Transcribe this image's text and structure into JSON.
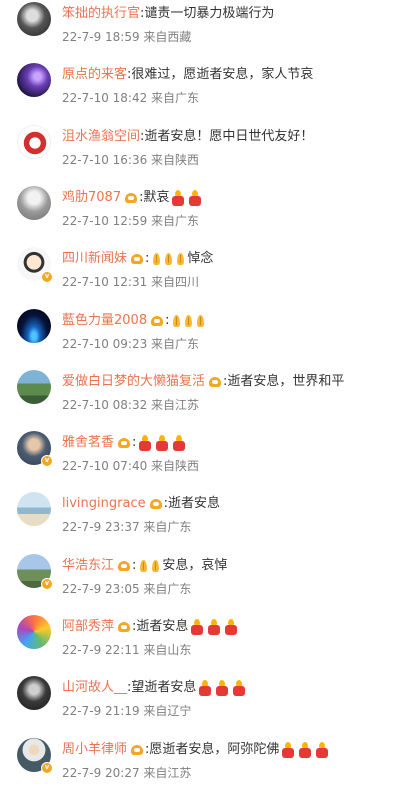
{
  "comments": [
    {
      "user": "笨拙的执行官",
      "text": ":谴责一切暴力极端行为",
      "badge": false,
      "fan": false,
      "emojis": [],
      "meta": "22-7-9 18:59 来自西藏",
      "avatar": "bw-portrait"
    },
    {
      "user": "原点的来客",
      "text": ":很难过，愿逝者安息，家人节哀",
      "badge": false,
      "fan": false,
      "emojis": [],
      "meta": "22-7-10 18:42 来自广东",
      "avatar": "galaxy"
    },
    {
      "user": "沮水渔翁空间",
      "text": ":逝者安息！愿中日世代友好！",
      "badge": false,
      "fan": false,
      "emojis": [],
      "meta": "22-7-10 16:36 来自陕西",
      "avatar": "red-seal"
    },
    {
      "user": "鸡肋7087",
      "text": ":默哀",
      "badge": false,
      "fan": true,
      "emojis": [
        "candle",
        "candle"
      ],
      "meta": "22-7-10 12:59 来自广东",
      "avatar": "gray-portrait"
    },
    {
      "user": "四川新闻妹",
      "text": "悼念",
      "badge": true,
      "fan": true,
      "emojis": [
        "colon",
        "pray",
        "pray",
        "pray"
      ],
      "meta": "22-7-10 12:31 来自四川",
      "avatar": "cartoon"
    },
    {
      "user": "藍色力量2008",
      "text": "",
      "badge": false,
      "fan": true,
      "emojis": [
        "colon",
        "pray",
        "pray",
        "pray"
      ],
      "meta": "22-7-10 09:23 来自广东",
      "avatar": "blue-planet"
    },
    {
      "user": "爱做白日梦的大懒猫复活",
      "text": ":逝者安息，世界和平",
      "badge": false,
      "fan": true,
      "emojis": [],
      "meta": "22-7-10 08:32 来自江苏",
      "avatar": "landscape"
    },
    {
      "user": "雅舍茗香",
      "text": "",
      "badge": true,
      "fan": true,
      "emojis": [
        "colon",
        "candle",
        "candle",
        "candle"
      ],
      "meta": "22-7-10 07:40 来自陕西",
      "avatar": "man-portrait"
    },
    {
      "user": "livingingrace",
      "text": ":逝者安息",
      "badge": false,
      "fan": true,
      "emojis": [],
      "meta": "22-7-9 23:37 来自广东",
      "avatar": "seaside"
    },
    {
      "user": "华浩东江",
      "text": "安息，哀悼",
      "badge": true,
      "fan": true,
      "emojis": [
        "colon",
        "pray",
        "pray"
      ],
      "meta": "22-7-9 23:05 来自广东",
      "avatar": "mountain"
    },
    {
      "user": "阿部秀萍",
      "text": ":逝者安息",
      "badge": false,
      "fan": true,
      "emojis": [
        "candle",
        "candle",
        "candle"
      ],
      "meta": "22-7-9 22:11 来自山东",
      "avatar": "colorful-bird"
    },
    {
      "user": "山河故人__",
      "text": ":望逝者安息",
      "badge": false,
      "fan": false,
      "emojis": [
        "candle",
        "candle",
        "candle"
      ],
      "meta": "22-7-9 21:19 来自辽宁",
      "avatar": "dark-portrait"
    },
    {
      "user": "周小羊律师",
      "text": ":愿逝者安息，阿弥陀佛",
      "badge": true,
      "fan": true,
      "emojis": [
        "candle",
        "candle",
        "candle"
      ],
      "meta": "22-7-9 20:27 来自江苏",
      "avatar": "suit-portrait"
    }
  ]
}
